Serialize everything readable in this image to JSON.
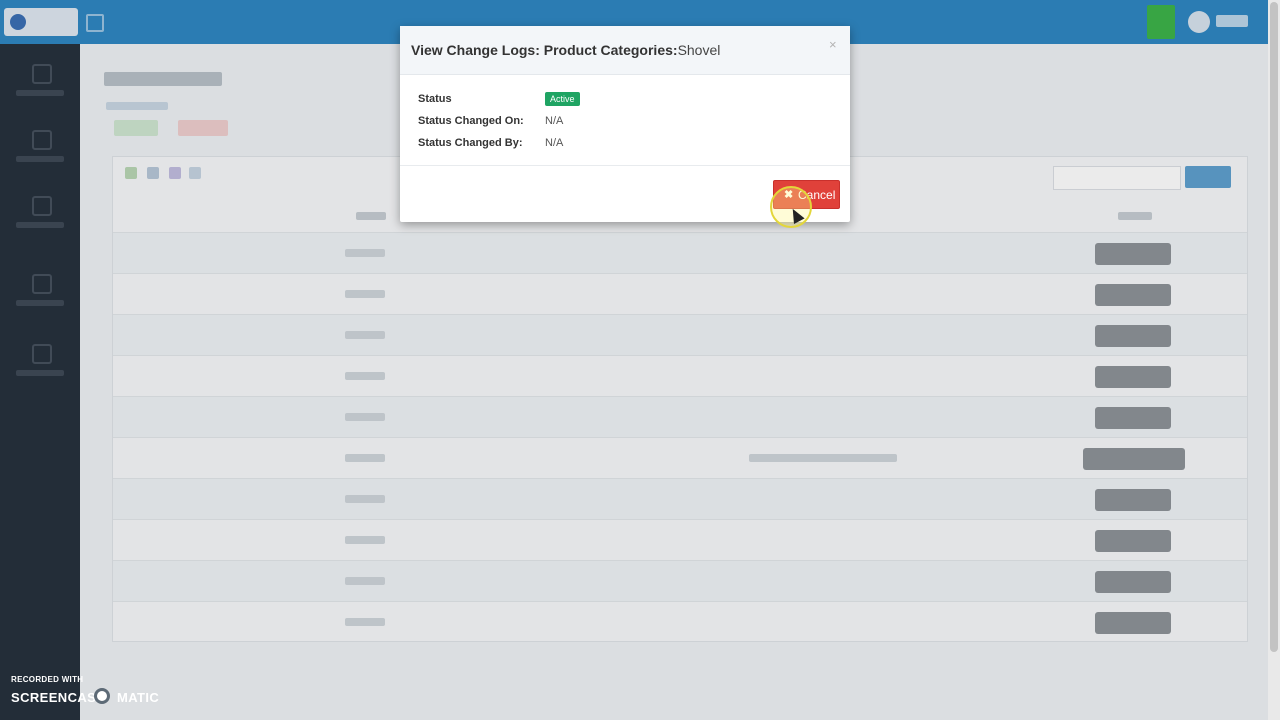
{
  "modal": {
    "title": "View Change Logs: Product Categories:",
    "subject": "Shovel",
    "close_glyph": "×",
    "fields": [
      {
        "label": "Status",
        "badge": "Active",
        "badge_color": "#1fa463"
      },
      {
        "label": "Status Changed On:",
        "value": "N/A"
      },
      {
        "label": "Status Changed By:",
        "value": "N/A"
      }
    ],
    "cancel_label": "Cancel",
    "cancel_icon": "close-icon",
    "cancel_color": "#e0413a"
  },
  "watermark": {
    "top": "RECORDED WITH",
    "left": "SCREENCAST",
    "right": "MATIC"
  },
  "colors": {
    "topbar": "#2f87c3",
    "sidebar": "#26313d",
    "notification": "#3db34a"
  }
}
